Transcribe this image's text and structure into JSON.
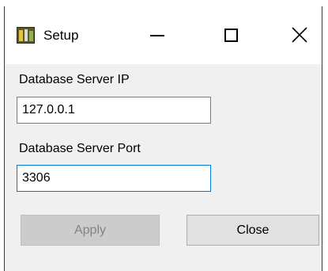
{
  "window": {
    "title": "Setup",
    "controls": {
      "minimize_icon": "minimize-icon",
      "maximize_icon": "maximize-icon",
      "close_icon": "close-icon"
    }
  },
  "form": {
    "ip_label": "Database Server IP",
    "ip_value": "127.0.0.1",
    "port_label": "Database Server Port",
    "port_value": "3306"
  },
  "buttons": {
    "apply_label": "Apply",
    "apply_enabled": false,
    "close_label": "Close"
  },
  "colors": {
    "focus_border": "#0078d7",
    "disabled_text": "#838383",
    "dialog_background": "#f0f0f0"
  }
}
